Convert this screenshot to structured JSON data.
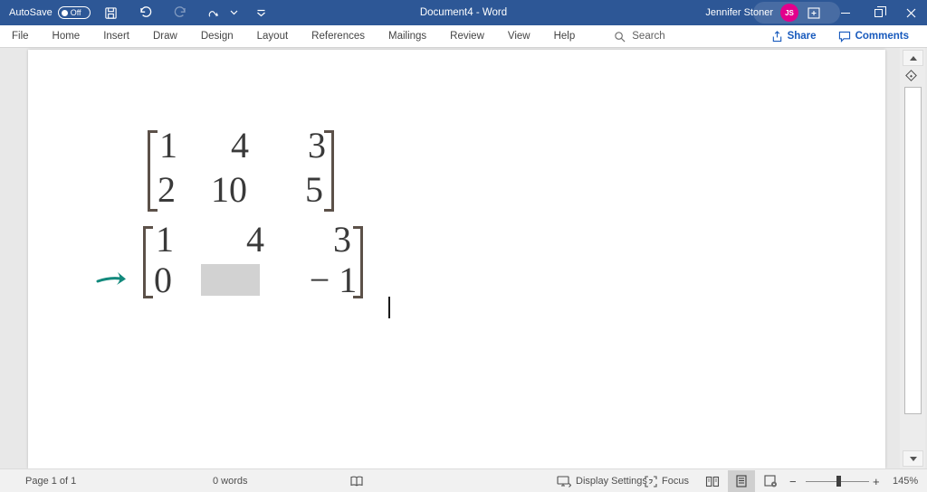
{
  "colors": {
    "titlebar": "#2d5796",
    "accent": "#185abd",
    "avatar": "#e3008c",
    "arrow_ink": "#12897c",
    "blank_box": "#d2d2d2",
    "matrix_ink": "#3a3a3a",
    "bracket_ink": "#5c5149"
  },
  "titlebar": {
    "autosave_label": "AutoSave",
    "autosave_state": "Off",
    "title": "Document4 - Word",
    "user_name": "Jennifer Stoner",
    "user_initials": "JS"
  },
  "ribbon": {
    "tabs": [
      "File",
      "Home",
      "Insert",
      "Draw",
      "Design",
      "Layout",
      "References",
      "Mailings",
      "Review",
      "View",
      "Help"
    ],
    "search_label": "Search",
    "share_label": "Share",
    "comments_label": "Comments"
  },
  "doc": {
    "m1": [
      [
        "1",
        "4",
        "3"
      ],
      [
        "2",
        "10",
        "5"
      ]
    ],
    "m2": [
      [
        "1",
        "4",
        "3"
      ],
      [
        "0",
        "",
        "− 1"
      ]
    ]
  },
  "statusbar": {
    "page_info": "Page 1 of 1",
    "word_count": "0 words",
    "display_settings_label": "Display Settings",
    "focus_label": "Focus",
    "zoom_out": "−",
    "zoom_in": "+",
    "zoom_level": "145%"
  }
}
